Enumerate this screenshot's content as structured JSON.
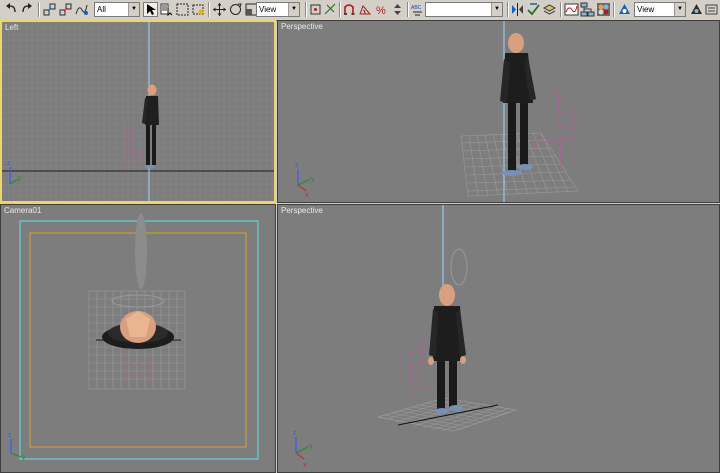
{
  "toolbar": {
    "selection_filter": "All",
    "ref_coord_system": "View",
    "named_selection": "",
    "render_view": "View",
    "icons": [
      "undo-icon",
      "redo-icon",
      "select-link-icon",
      "unlink-icon",
      "bind-spacewarp-icon",
      "select-arrow-icon",
      "select-by-name-icon",
      "rect-selection-icon",
      "window-crossing-icon",
      "move-icon",
      "rotate-icon",
      "scale-icon",
      "snaps-toggle-icon",
      "angle-snap-icon",
      "percent-snap-icon",
      "spinner-snap-icon",
      "edit-named-selection-icon",
      "mirror-icon",
      "align-icon",
      "layer-manager-icon",
      "curve-editor-icon",
      "schematic-view-icon",
      "material-editor-icon",
      "render-scene-icon",
      "quick-render-icon"
    ]
  },
  "viewports": {
    "top_left": {
      "label": "Left",
      "active": true
    },
    "top_right": {
      "label": "Perspective",
      "active": false
    },
    "bottom_left": {
      "label": "Camera01",
      "active": false
    },
    "bottom_right": {
      "label": "Perspective",
      "active": false
    }
  },
  "axis_labels": {
    "x": "x",
    "y": "y",
    "z": "z"
  },
  "colors": {
    "viewport_bg": "#7d7d7d",
    "active_border": "#ecd56a",
    "grid": "#8e8e8e",
    "skin": "#d9a080",
    "clothes": "#1f1f1f",
    "chair": "#a26a8e",
    "light_line": "#9fd6ff",
    "safe_frame_outer": "#5ee0f0",
    "safe_frame_inner": "#e0a020"
  }
}
